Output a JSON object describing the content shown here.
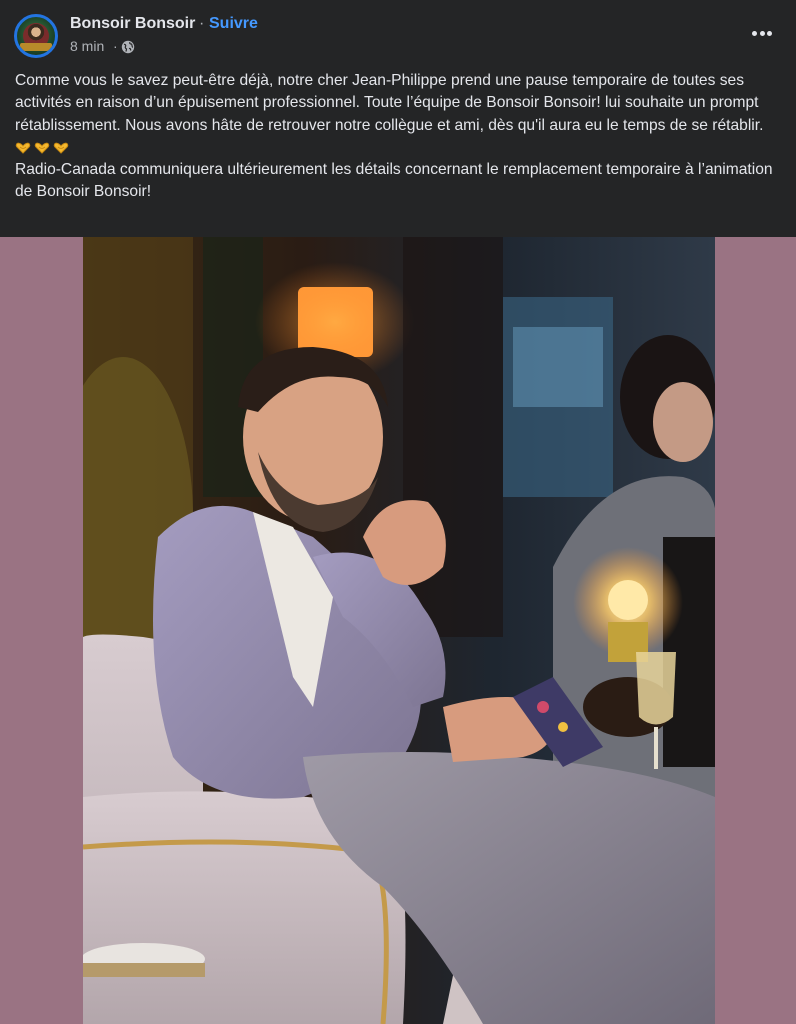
{
  "post": {
    "page_name": "Bonsoir Bonsoir",
    "separator": "·",
    "follow_label": "Suivre",
    "time": "8 min",
    "time_separator": "·",
    "audience_icon": "globe-icon",
    "more_icon": "more-options-icon",
    "avatar_text": "BONSOIR!",
    "paragraphs": [
      "Comme vous le savez peut-être déjà, notre cher Jean-Philippe prend une pause temporaire de toutes ses activités en raison d’un épuisement professionnel. Toute l’équipe de Bonsoir Bonsoir! lui souhaite un prompt rétablissement. Nous avons hâte de retrouver notre collègue et ami, dès qu'il aura eu le temps de se rétablir.",
      "Radio-Canada communiquera ultérieurement les détails concernant le remplacement temporaire à l’animation de Bonsoir Bonsoir!"
    ],
    "emoji_icons": [
      "heart-hands-icon",
      "heart-hands-icon",
      "heart-hands-icon"
    ]
  },
  "photo": {
    "description_icon": "photo-of-host-seated-in-armchair"
  },
  "colors": {
    "background": "#242526",
    "text": "#e4e6eb",
    "secondary_text": "#b0b3b8",
    "link": "#4599ff",
    "photo_matte": "#9a7383"
  }
}
